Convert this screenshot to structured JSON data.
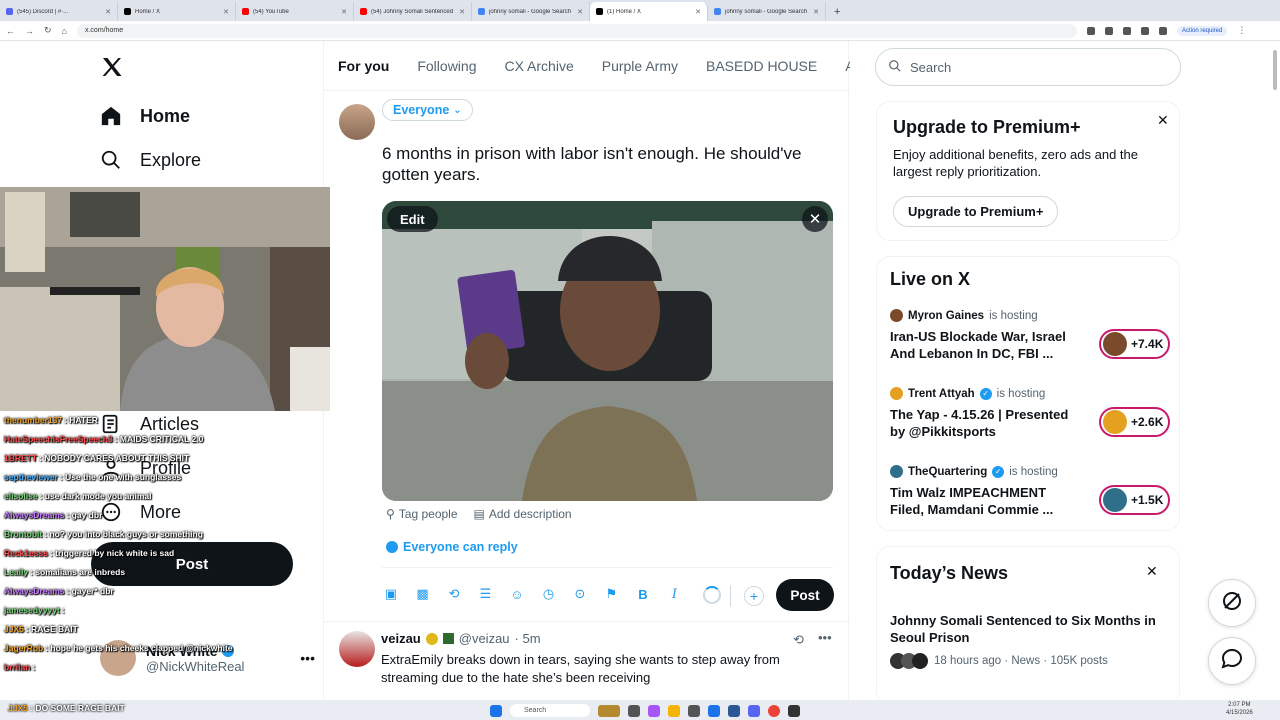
{
  "browser": {
    "tabs": [
      {
        "label": "(545) Discord | #·...",
        "extra": "general |",
        "active": false,
        "color": "#5865f2"
      },
      {
        "label": "Home / X",
        "active": false,
        "color": "#000000"
      },
      {
        "label": "(54) YouTube",
        "active": false,
        "color": "#ff0000"
      },
      {
        "label": "(54) Johnny Somali Sentenced t...",
        "active": false,
        "color": "#ff0000"
      },
      {
        "label": "johnny somali - Google Search",
        "active": false,
        "color": "#4285f4"
      },
      {
        "label": "(1) Home / X",
        "active": true,
        "color": "#000000"
      },
      {
        "label": "johnny somali - Google Search",
        "active": false,
        "color": "#4285f4"
      }
    ],
    "url": "x.com/home",
    "action_required": "Action required"
  },
  "nav": {
    "home": "Home",
    "explore": "Explore",
    "articles": "Articles",
    "profile": "Profile",
    "more": "More",
    "post": "Post",
    "account_name": "Nick White",
    "account_handle": "@NickWhiteReal"
  },
  "feed_tabs": [
    "For you",
    "Following",
    "CX Archive",
    "Purple Army",
    "BASEDD HOUSE",
    "Apo"
  ],
  "composer": {
    "audience": "Everyone",
    "text": "6 months in prison with labor isn't enough. He should've gotten years.",
    "edit": "Edit",
    "tag_people": "Tag people",
    "add_description": "Add description",
    "reply_setting": "Everyone can reply",
    "post": "Post"
  },
  "feed_post": {
    "name": "veizau",
    "handle": "@veizau",
    "time": "· 5m",
    "text": "ExtraEmily breaks down in tears, saying she wants to step away from streaming due to the hate she’s been receiving"
  },
  "sidebar": {
    "search_placeholder": "Search",
    "premium": {
      "title": "Upgrade to Premium+",
      "body": "Enjoy additional benefits, zero ads and the largest reply prioritization.",
      "button": "Upgrade to Premium+"
    },
    "live": {
      "title": "Live on X",
      "hosting": "is hosting",
      "items": [
        {
          "host": "Myron Gaines",
          "verified": false,
          "title": "Iran-US Blockade War, Israel And Lebanon In DC, FBI ...",
          "count": "+7.4K",
          "avatar": "#7a4a2a"
        },
        {
          "host": "Trent Attyah",
          "verified": true,
          "title": "The Yap - 4.15.26 | Presented by @Pikkitsports",
          "count": "+2.6K",
          "avatar": "#e6a020"
        },
        {
          "host": "TheQuartering",
          "verified": true,
          "title": "Tim Walz IMPEACHMENT Filed, Mamdani Commie ...",
          "count": "+1.5K",
          "avatar": "#2f6f8a"
        }
      ]
    },
    "news": {
      "title": "Today’s News",
      "headline": "Johnny Somali Sentenced to Six Months in Seoul Prison",
      "meta": "18 hours ago · News · 105K posts"
    }
  },
  "chat": [
    {
      "user": "thenumber137",
      "msg": ": HATER",
      "color": "#f5a623"
    },
    {
      "user": "HateSpeechIsFreeSpeech3",
      "msg": ": MAIDS CRITICAL 2.0",
      "color": "#ff4d4d"
    },
    {
      "user": "1BRETT",
      "msg": ": NOBODY CARES ABOUT THIS SHIT",
      "color": "#ff4d4d"
    },
    {
      "user": "septheviewer",
      "msg": ": Use the one with sunglasses",
      "color": "#4fb3ff"
    },
    {
      "user": "elisolise",
      "msg": ": use dark mode you animal",
      "color": "#7cd97c"
    },
    {
      "user": "AlwaysDreams",
      "msg": ": gay dbr",
      "color": "#c77dff"
    },
    {
      "user": "Brontobit",
      "msg": ": no? you into black guys or something",
      "color": "#7cd97c"
    },
    {
      "user": "Reck1esss",
      "msg": ": triggered by nick white is sad",
      "color": "#ff4d4d"
    },
    {
      "user": "Leaily",
      "msg": ": somalians are inbreds",
      "color": "#7cd97c"
    },
    {
      "user": "AlwaysDreams",
      "msg": ": gayer* dbr",
      "color": "#c77dff"
    },
    {
      "user": "jamesedyyyyt",
      "msg": ":",
      "color": "#7cd97c"
    },
    {
      "user": "JJX5",
      "msg": ": RAGE BAIT",
      "color": "#f5a623"
    },
    {
      "user": "JagerRob",
      "msg": ": hope he gets his cheeks clapped @nickwhite",
      "color": "#f5a623"
    },
    {
      "user": "brrilan",
      "msg": ":",
      "color": "#ff4d4d"
    },
    {
      "user": "JJX5",
      "msg": ": DO SOME RAGE BAIT",
      "color": "#f5a623"
    }
  ],
  "taskbar": {
    "search": "Search",
    "time": "2:07 PM",
    "date": "4/15/2026"
  }
}
